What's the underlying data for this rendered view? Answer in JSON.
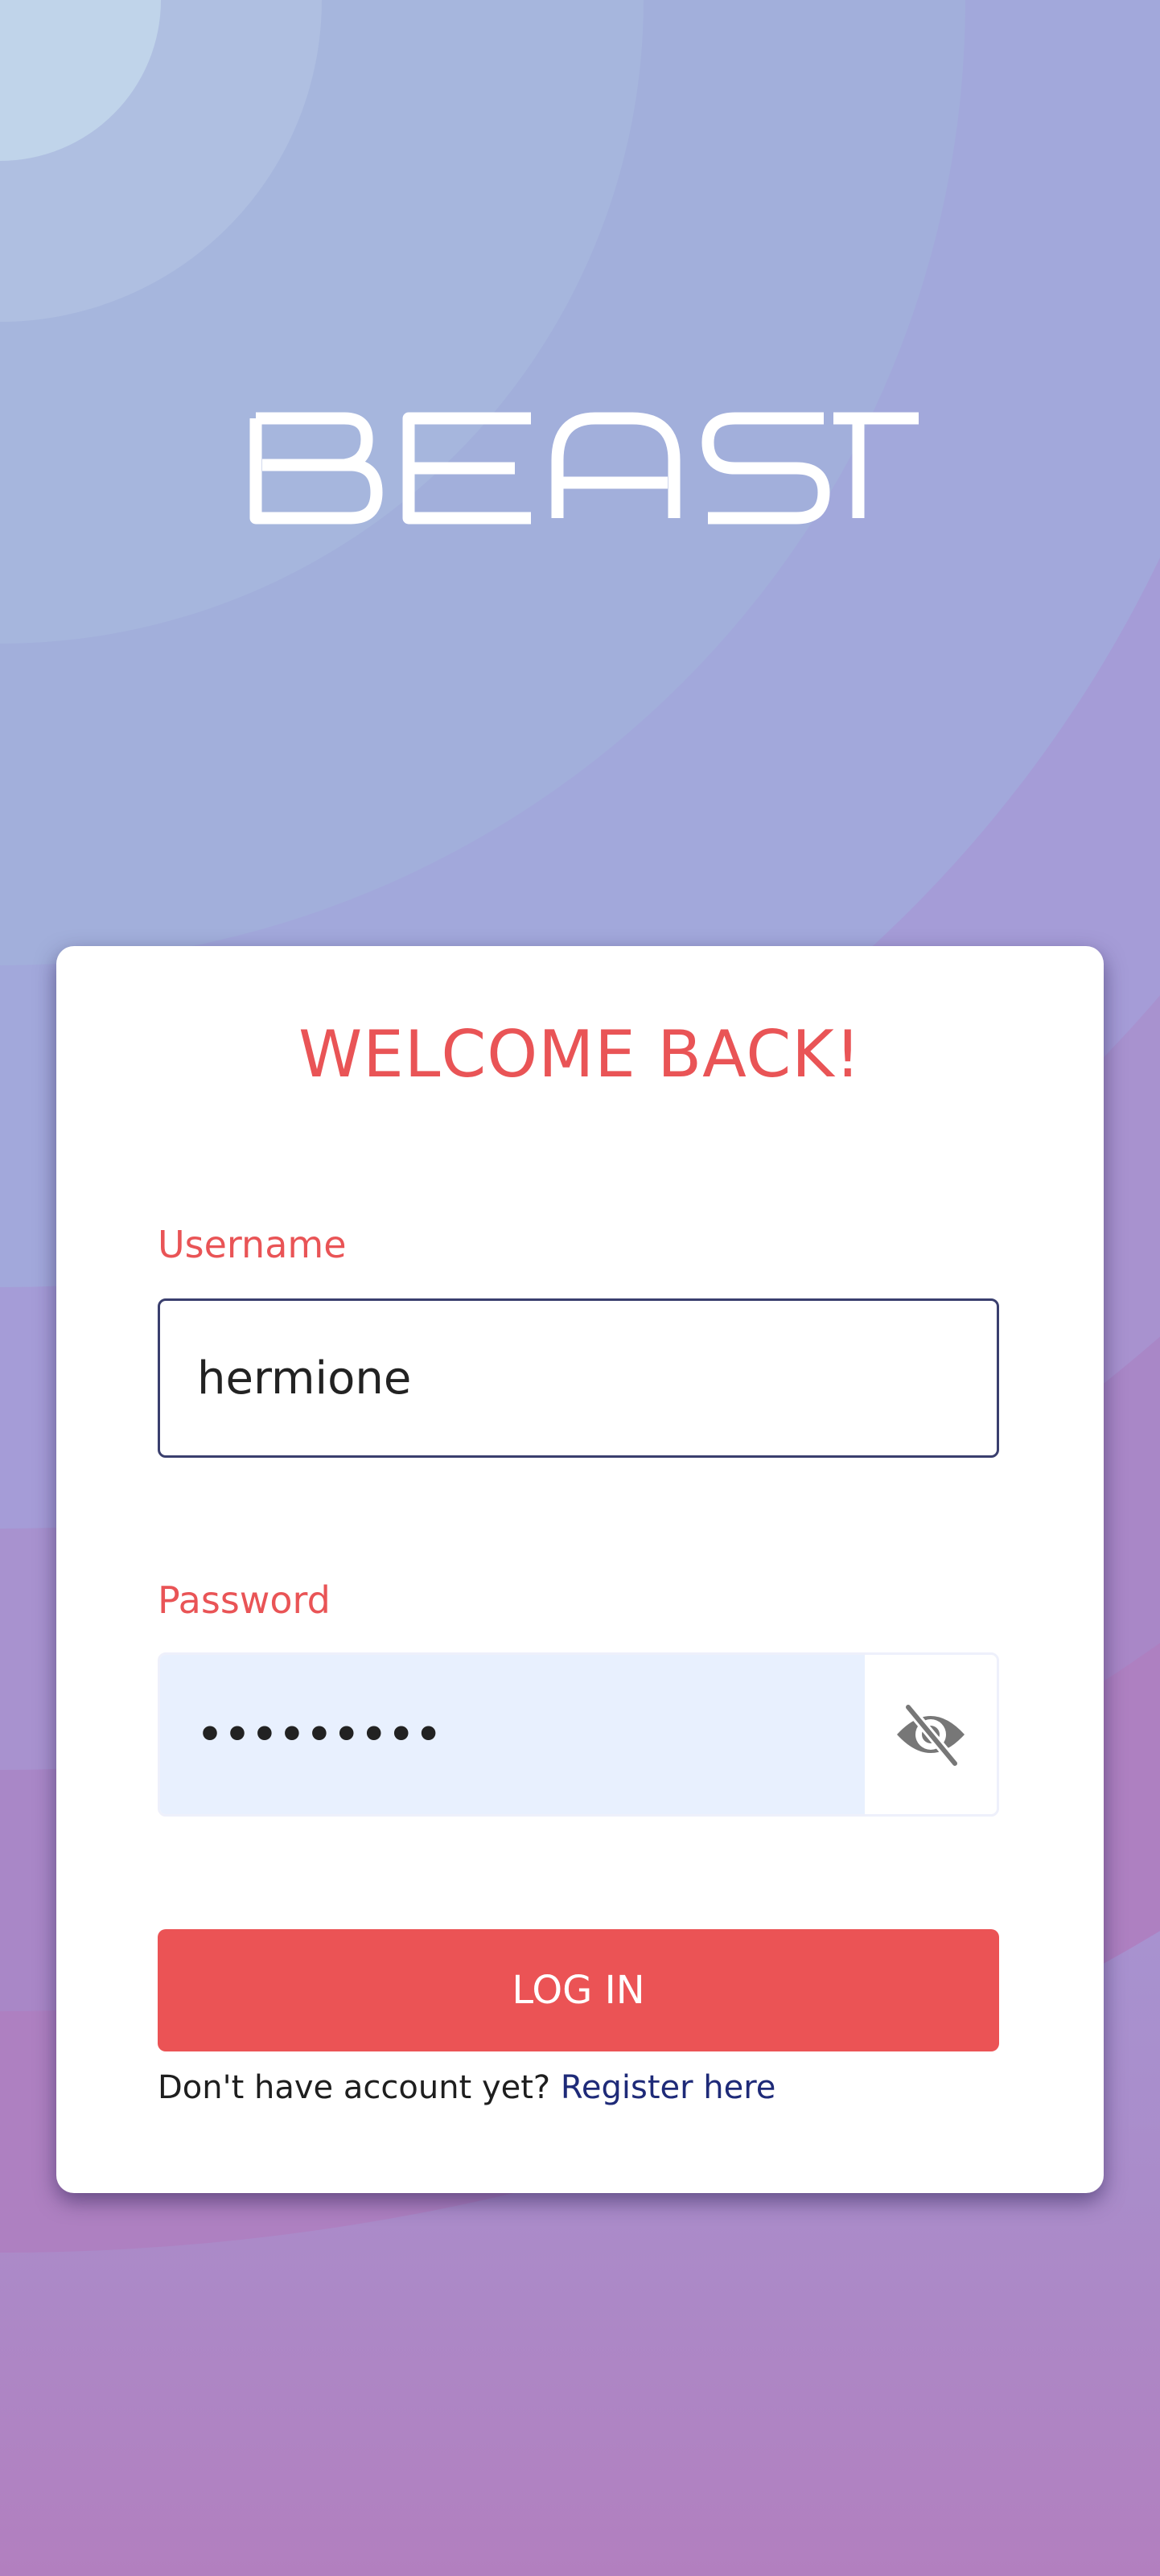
{
  "app": {
    "logo_text": "BEAST"
  },
  "login": {
    "title": "WELCOME BACK!",
    "username_label": "Username",
    "username_value": "hermione",
    "password_label": "Password",
    "password_value": "hermione1",
    "password_toggle_icon": "eye-off-icon",
    "submit_label": "LOG IN",
    "register_prompt": "Don't have account yet?",
    "register_link": "Register here"
  },
  "colors": {
    "accent": "#eb5355",
    "link": "#1e2a78",
    "input_border": "#3a3f6e",
    "autofill_bg": "#e8f0fe"
  }
}
